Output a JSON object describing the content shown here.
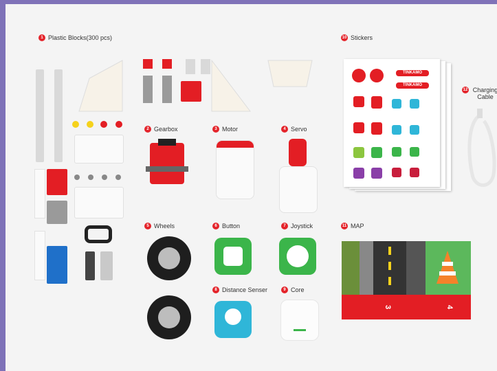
{
  "labels": {
    "plastic_blocks": {
      "num": "1",
      "text": "Plastic Blocks(300 pcs)"
    },
    "gearbox": {
      "num": "2",
      "text": "Gearbox"
    },
    "motor": {
      "num": "3",
      "text": "Motor"
    },
    "servo": {
      "num": "4",
      "text": "Servo"
    },
    "wheels": {
      "num": "5",
      "text": "Wheels"
    },
    "button": {
      "num": "6",
      "text": "Button"
    },
    "joystick": {
      "num": "7",
      "text": "Joystick"
    },
    "distance_sensor": {
      "num": "8",
      "text": "Distance Senser"
    },
    "core": {
      "num": "9",
      "text": "Core"
    },
    "stickers": {
      "num": "10",
      "text": "Stickers"
    },
    "map": {
      "num": "11",
      "text": "MAP"
    },
    "charging_cable": {
      "num": "12",
      "text": "Charging Cable"
    }
  },
  "sticker_brand": "TINKAMO",
  "map_numbers": {
    "left": "3",
    "right": "4"
  },
  "colors": {
    "frame": "#7f72b8",
    "background": "#f4f4f4",
    "badge_red": "#e4242b",
    "accent_green": "#3bb54a",
    "accent_blue": "#2fb6d8"
  }
}
